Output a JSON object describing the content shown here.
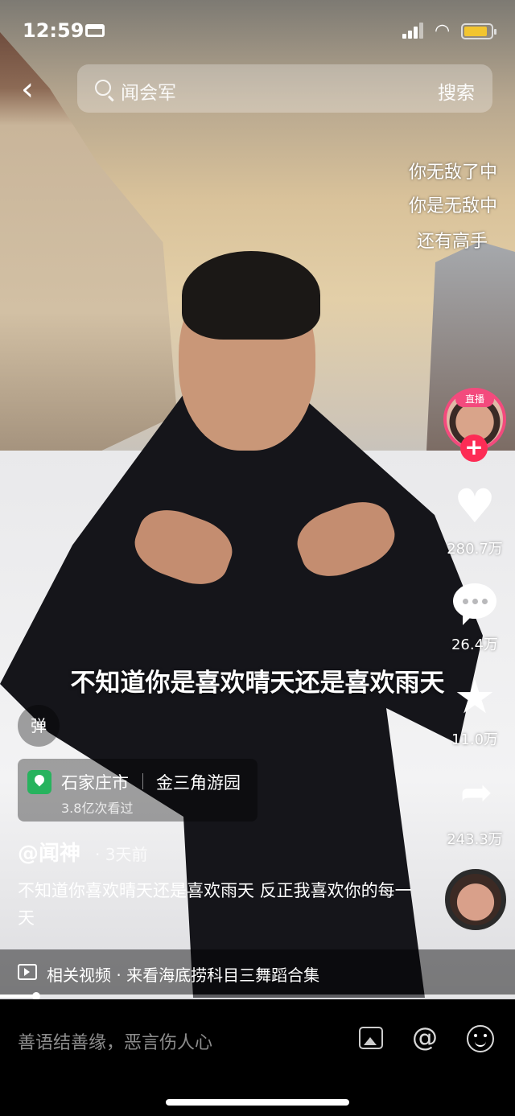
{
  "status_bar": {
    "time": "12:59"
  },
  "search": {
    "query": "闻会军",
    "button_label": "搜索"
  },
  "danmaku": [
    "你无敌了中",
    "你是无敌中",
    "还有高手"
  ],
  "live_badge": "直播",
  "follow_symbol": "+",
  "actions": {
    "likes": "280.7万",
    "comments": "26.4万",
    "favorites": "11.0万",
    "shares": "243.3万"
  },
  "subtitle": "不知道你是喜欢晴天还是喜欢雨天",
  "danmu_toggle_label": "弹",
  "location": {
    "city": "石家庄市",
    "place": "金三角游园",
    "views": "3.8亿次看过"
  },
  "post": {
    "author": "@闻神",
    "time_ago": "· 3天前",
    "caption": "不知道你喜欢晴天还是喜欢雨天 反正我喜欢你的每一天"
  },
  "related": {
    "text": "相关视频 · 来看海底捞科目三舞蹈合集"
  },
  "playback": {
    "progress_fraction": 0.07
  },
  "comment_bar": {
    "placeholder": "善语结善缘，恶言伤人心"
  },
  "icons": [
    "back-icon",
    "search-icon",
    "heart-icon",
    "comment-icon",
    "star-icon",
    "share-icon",
    "image-icon",
    "at-icon",
    "emoji-icon",
    "video-icon",
    "location-pin-icon"
  ]
}
